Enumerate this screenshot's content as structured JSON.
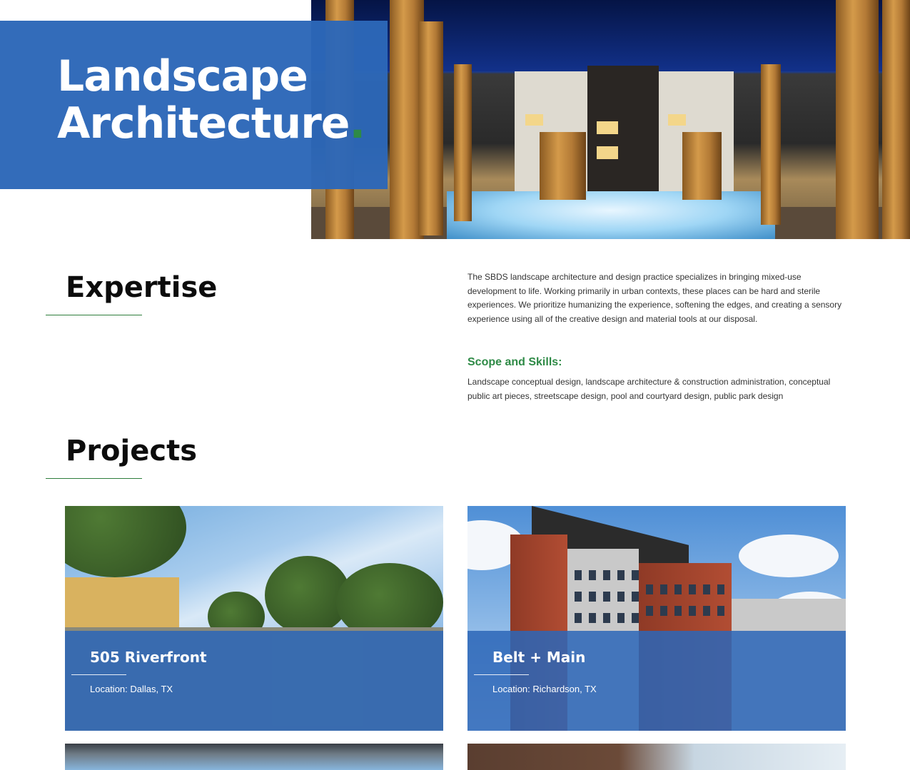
{
  "hero": {
    "title_line1": "Landscape",
    "title_line2": "Architecture",
    "title_dot": ".",
    "accent_color": "#2e8a46",
    "box_color": "#2c67b8"
  },
  "expertise": {
    "heading": "Expertise",
    "intro": "The SBDS landscape architecture and design practice specializes in bringing mixed-use development to life.  Working primarily in urban contexts, these places can be hard and sterile experiences.  We prioritize humanizing the experience, softening the edges, and creating a sensory experience using all of the creative design and material tools at our disposal.",
    "scope_title": "Scope and Skills:",
    "scope_text": "Landscape conceptual design, landscape architecture & construction administration, conceptual public art pieces, streetscape design, pool and courtyard design, public park design"
  },
  "projects": {
    "heading": "Projects",
    "items": [
      {
        "name": "505 Riverfront",
        "location": "Location: Dallas, TX"
      },
      {
        "name": "Belt + Main",
        "location": "Location: Richardson, TX"
      }
    ]
  }
}
